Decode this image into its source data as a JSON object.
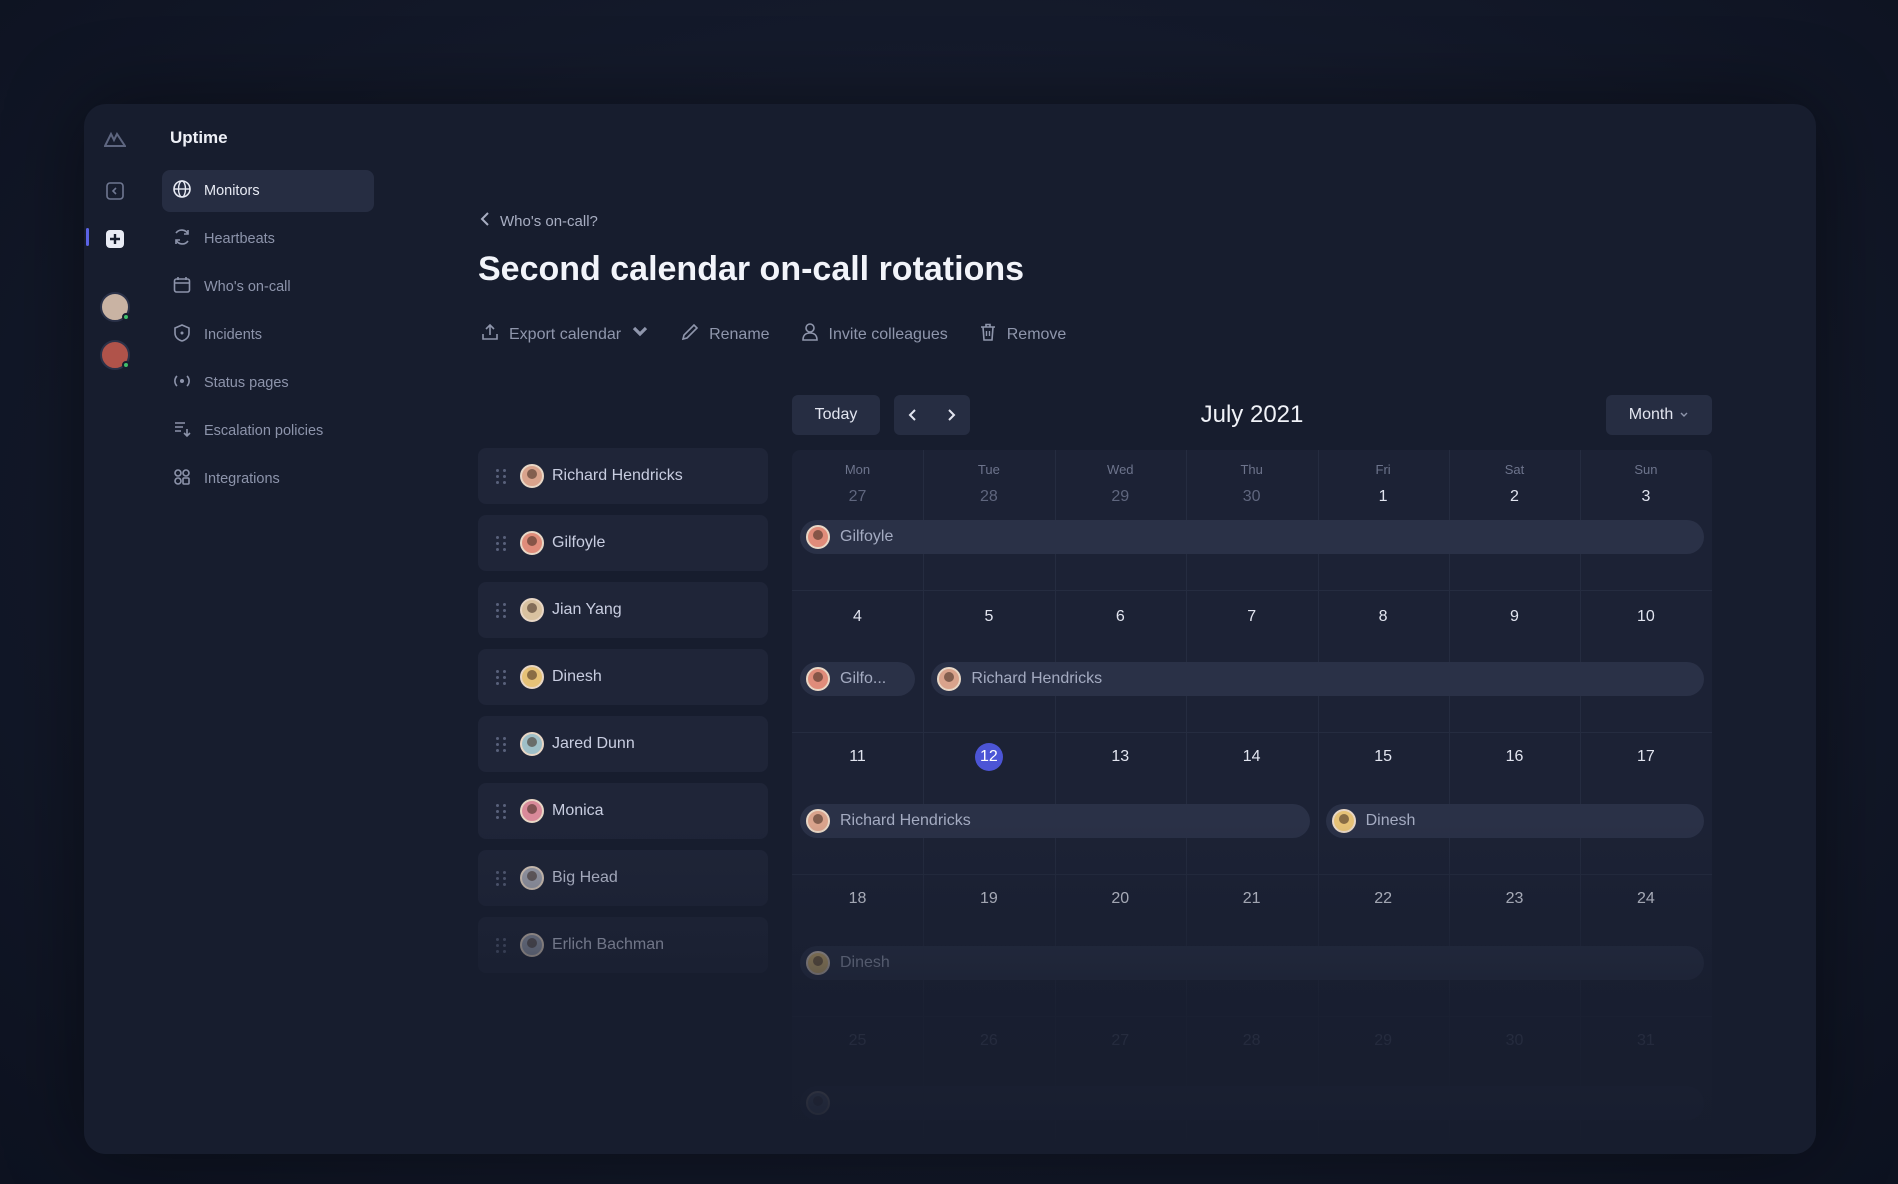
{
  "app": {
    "name": "Uptime"
  },
  "nav": [
    {
      "label": "Monitors",
      "icon": "globe-icon",
      "active": true
    },
    {
      "label": "Heartbeats",
      "icon": "refresh-icon"
    },
    {
      "label": "Who's on-call",
      "icon": "calendar-icon"
    },
    {
      "label": "Incidents",
      "icon": "shield-icon"
    },
    {
      "label": "Status pages",
      "icon": "broadcast-icon"
    },
    {
      "label": "Escalation policies",
      "icon": "escalation-icon"
    },
    {
      "label": "Integrations",
      "icon": "integrations-icon"
    }
  ],
  "breadcrumb": {
    "back_label": "Who's on-call?"
  },
  "page": {
    "title": "Second calendar on-call rotations"
  },
  "actions": {
    "export": "Export calendar",
    "rename": "Rename",
    "invite": "Invite colleagues",
    "remove": "Remove"
  },
  "people": [
    {
      "name": "Richard Hendricks",
      "avatar_color": "#d9a38c"
    },
    {
      "name": "Gilfoyle",
      "avatar_color": "#e08c7a"
    },
    {
      "name": "Jian Yang",
      "avatar_color": "#d9c2a0"
    },
    {
      "name": "Dinesh",
      "avatar_color": "#e6c277"
    },
    {
      "name": "Jared Dunn",
      "avatar_color": "#9fc0c8"
    },
    {
      "name": "Monica",
      "avatar_color": "#d98a9a"
    },
    {
      "name": "Big Head",
      "avatar_color": "#a7a9b5"
    },
    {
      "name": "Erlich Bachman",
      "avatar_color": "#9aa0b0"
    }
  ],
  "calendar": {
    "today_label": "Today",
    "month_label": "July 2021",
    "view_label": "Month",
    "weekdays": [
      "Mon",
      "Tue",
      "Wed",
      "Thu",
      "Fri",
      "Sat",
      "Sun"
    ],
    "weeks": [
      [
        "27",
        "28",
        "29",
        "30",
        "1",
        "2",
        "3"
      ],
      [
        "4",
        "5",
        "6",
        "7",
        "8",
        "9",
        "10"
      ],
      [
        "11",
        "12",
        "13",
        "14",
        "15",
        "16",
        "17"
      ],
      [
        "18",
        "19",
        "20",
        "21",
        "22",
        "23",
        "24"
      ],
      [
        "25",
        "26",
        "27",
        "28",
        "29",
        "30",
        "31"
      ]
    ],
    "today_date": "12",
    "shifts": [
      {
        "week": 0,
        "start": 0,
        "end": 6,
        "name": "Gilfoyle"
      },
      {
        "week": 1,
        "start": 0,
        "end": 0,
        "name": "Gilfo..."
      },
      {
        "week": 1,
        "start": 1,
        "end": 6,
        "name": "Richard Hendricks"
      },
      {
        "week": 2,
        "start": 0,
        "end": 3,
        "name": "Richard Hendricks"
      },
      {
        "week": 2,
        "start": 4,
        "end": 6,
        "name": "Dinesh"
      },
      {
        "week": 3,
        "start": 0,
        "end": 6,
        "name": "Dinesh"
      },
      {
        "week": 4,
        "start": 0,
        "end": 6,
        "name": ""
      }
    ]
  },
  "colors": {
    "accent": "#4c55d6",
    "online": "#3fbf6b"
  }
}
